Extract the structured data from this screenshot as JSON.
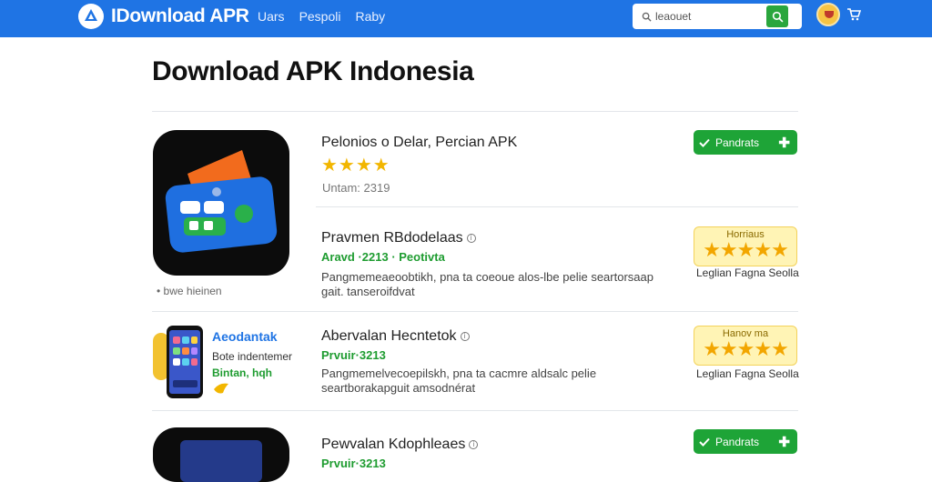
{
  "header": {
    "brand": "IDownload APR",
    "nav": [
      "Uars",
      "Pespoli",
      "Raby"
    ],
    "search": {
      "value": "leaouet"
    },
    "colors": {
      "bar": "#1f74e4",
      "accent": "#2aa63d"
    }
  },
  "page": {
    "title": "Download APK Indonesia"
  },
  "items": [
    {
      "title": "Pelonios o Delar, Percian APK",
      "rating": 4,
      "sub": "Untam: 2319",
      "button": "Pandrats",
      "icon_note": "bwe hieinen"
    },
    {
      "title": "Pravmen RBdodelaas",
      "green": "Aravd ·2213 · Peotivta",
      "desc": "Pangmemeaeoobtikh, pna ta coeoue alos-lbe pelie seartorsaap gait. tanseroifdvat",
      "badge": "Horriaus",
      "badge_stars": 5,
      "caption": "Leglian Fagna Seolla"
    },
    {
      "title": "Abervalan Hecntetok",
      "green": "Prvuir·3213",
      "desc": "Pangmemelvecoepilskh, pna ta cacmre aldsalc pelie seartborakapguit amsodnérat",
      "badge": "Hanov ma",
      "badge_stars": 5,
      "caption": "Leglian Fagna Seolla",
      "side_title": "Aeodantak",
      "side_line1": "Bote indentemer",
      "side_line2": "Bintan, hqh"
    },
    {
      "title": "Pewvalan Kdophleaes",
      "green": "Prvuir·3213",
      "button": "Pandrats"
    }
  ]
}
